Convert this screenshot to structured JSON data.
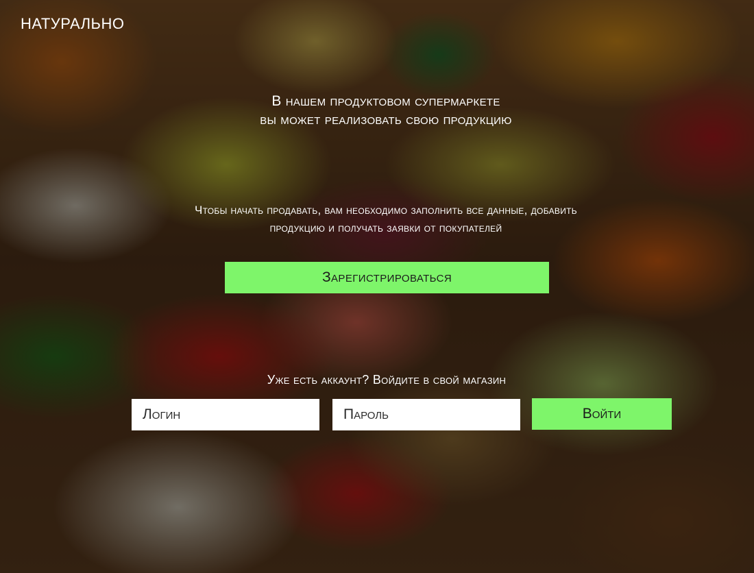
{
  "brand": {
    "logo_text": "Натурально"
  },
  "hero": {
    "headline_line1": "В нашем продуктовом супермаркете",
    "headline_line2": "вы может реализовать свою продукцию",
    "lead_line1": "Чтобы начать продавать, вам необходимо заполнить все данные, добавить",
    "lead_line2": "продукцию и получать заявки от покупателей",
    "register_label": "Зарегистрироваться"
  },
  "login": {
    "hint": "Уже есть аккаунт? Войдите в свой магазин",
    "login_placeholder": "Логин",
    "password_placeholder": "Пароль",
    "submit_label": "Войти"
  },
  "colors": {
    "accent": "#7ef56a",
    "overlay": "rgba(0,0,0,0.52)",
    "text": "#ffffff"
  }
}
